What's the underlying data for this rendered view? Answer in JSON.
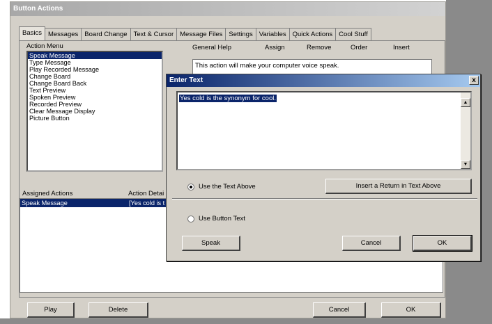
{
  "main_window": {
    "title": "Button Actions",
    "tabs": [
      {
        "label": "Basics"
      },
      {
        "label": "Messages"
      },
      {
        "label": "Board Change"
      },
      {
        "label": "Text & Cursor"
      },
      {
        "label": "Message Files"
      },
      {
        "label": "Settings"
      },
      {
        "label": "Variables"
      },
      {
        "label": "Quick Actions"
      },
      {
        "label": "Cool Stuff"
      }
    ],
    "action_menu_label": "Action Menu",
    "action_menu_items": [
      "Speak Message",
      "Type Message",
      "Play Recorded Message",
      "Change Board",
      "Change Board Back",
      "Text Preview",
      "Spoken Preview",
      "Recorded Preview",
      "Clear Message Display",
      "Picture Button"
    ],
    "selected_action_index": 0,
    "help_headers": {
      "general_help": "General Help",
      "assign": "Assign",
      "remove": "Remove",
      "order": "Order",
      "insert": "Insert"
    },
    "help_text": "This action will make your computer voice speak.",
    "assigned_actions_header": "Assigned Actions",
    "action_details_header": "Action Detai",
    "assigned_rows": [
      {
        "action": "Speak Message",
        "detail": "[Yes cold is t"
      }
    ],
    "buttons": {
      "play": "Play",
      "delete": "Delete",
      "cancel": "Cancel",
      "ok": "OK"
    }
  },
  "dialog": {
    "title": "Enter Text",
    "close_glyph": "x",
    "text_value": "Yes cold is the synonym for cool.",
    "radio_use_text_above": "Use the Text Above",
    "radio_use_button_text": "Use Button Text",
    "selected_radio": "use_text_above",
    "insert_return_button": "Insert a Return in Text Above",
    "speak_button": "Speak",
    "cancel_button": "Cancel",
    "ok_button": "OK"
  }
}
